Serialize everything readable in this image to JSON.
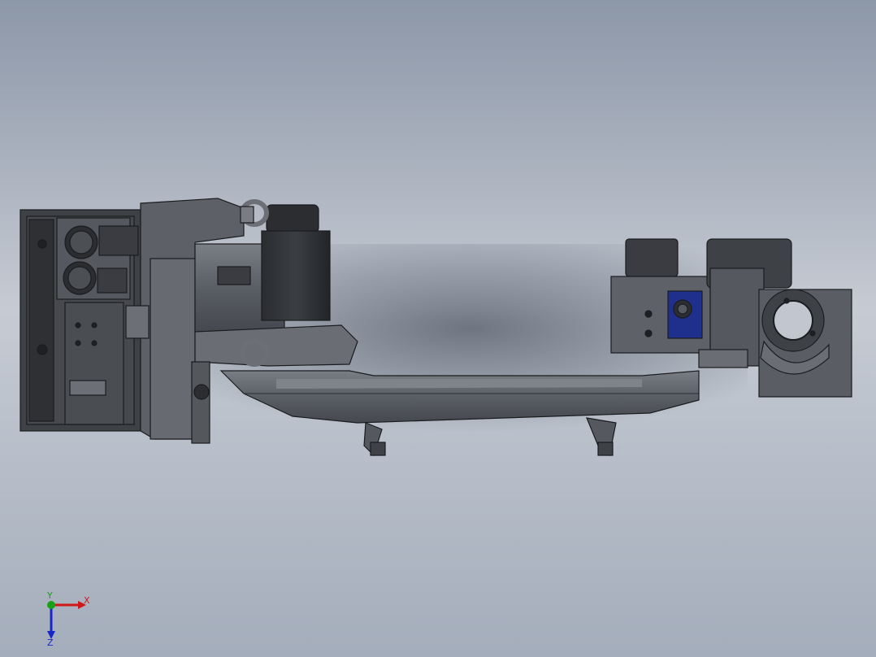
{
  "viewport": {
    "background_top": "#8c97a8",
    "background_mid": "#c6cbd3",
    "background_bottom": "#a4adbb"
  },
  "model": {
    "body_color": "#5f6368",
    "dark_color": "#2b2d31",
    "edge_color": "#1b1c1f",
    "accent_color": "#1e2f8c"
  },
  "triad": {
    "x_label": "X",
    "y_label": "Y",
    "z_label": "Z",
    "x_color": "#d01818",
    "y_color": "#18a018",
    "z_color": "#1828c8"
  }
}
